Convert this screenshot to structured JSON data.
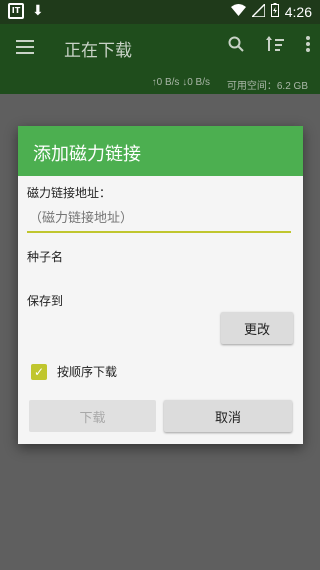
{
  "status_bar": {
    "app_icon": "IT",
    "download_icon": "download-arrow",
    "wifi_icon": "wifi",
    "signal_icon": "signal",
    "battery_icon": "battery",
    "time": "4:26"
  },
  "toolbar": {
    "title": "正在下载",
    "menu_icon": "hamburger",
    "search_icon": "search",
    "sort_icon": "sort",
    "more_icon": "more-vert"
  },
  "speed_bar": {
    "speeds": "↑0 B/s ↓0 B/s",
    "free_space": "可用空间：6.2 GB"
  },
  "dialog": {
    "title": "添加磁力链接",
    "magnet_label": "磁力链接地址：",
    "magnet_placeholder": "（磁力链接地址）",
    "torrent_name_label": "种子名",
    "save_to_label": "保存到",
    "change_button": "更改",
    "sequential_label": "按顺序下载",
    "sequential_checked": true,
    "download_button": "下载",
    "cancel_button": "取消"
  },
  "colors": {
    "dialog_header": "#4caf50",
    "accent": "#c0c62e",
    "toolbar": "#1f4d1c"
  }
}
